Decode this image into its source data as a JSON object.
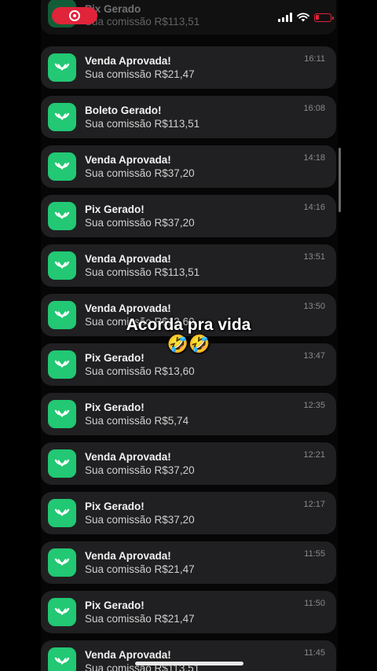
{
  "status_bar": {
    "signal": "cellular-signal-icon",
    "wifi": "wifi-icon",
    "battery": "battery-low-icon",
    "recording_color": "#e0243a"
  },
  "accent_color": "#22c873",
  "top_partial": {
    "title": "Pix Gerado",
    "body": "Sua comissão R$113,51"
  },
  "notifications": [
    {
      "title": "Venda Aprovada!",
      "body": "Sua comissão R$21,47",
      "time": "16:11"
    },
    {
      "title": "Boleto Gerado!",
      "body": "Sua comissão R$113,51",
      "time": "16:08"
    },
    {
      "title": "Venda Aprovada!",
      "body": "Sua comissão R$37,20",
      "time": "14:18"
    },
    {
      "title": "Pix Gerado!",
      "body": "Sua comissão R$37,20",
      "time": "14:16"
    },
    {
      "title": "Venda Aprovada!",
      "body": "Sua comissão R$113,51",
      "time": "13:51"
    },
    {
      "title": "Venda Aprovada!",
      "body": "Sua comissão R$13,60",
      "time": "13:50"
    },
    {
      "title": "Pix Gerado!",
      "body": "Sua comissão R$13,60",
      "time": "13:47"
    },
    {
      "title": "Pix Gerado!",
      "body": "Sua comissão R$5,74",
      "time": "12:35"
    },
    {
      "title": "Venda Aprovada!",
      "body": "Sua comissão R$37,20",
      "time": "12:21"
    },
    {
      "title": "Pix Gerado!",
      "body": "Sua comissão R$37,20",
      "time": "12:17"
    },
    {
      "title": "Venda Aprovada!",
      "body": "Sua comissão R$21,47",
      "time": "11:55"
    },
    {
      "title": "Pix Gerado!",
      "body": "Sua comissão R$21,47",
      "time": "11:50"
    },
    {
      "title": "Venda Aprovada!",
      "body": "Sua comissão R$113,51",
      "time": "11:45"
    }
  ],
  "caption": {
    "text": "Acorda pra vida",
    "emoji": "🤣🤣"
  }
}
